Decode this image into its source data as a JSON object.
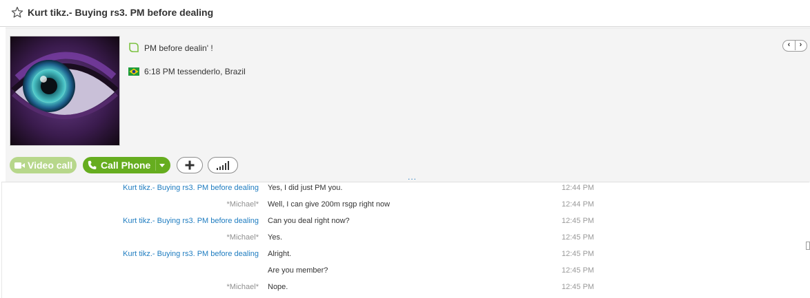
{
  "header": {
    "title": "Kurt tikz.- Buying rs3. PM before dealing"
  },
  "profile": {
    "mood": "PM before dealin' !",
    "location": "6:18 PM tessenderlo, Brazil",
    "mood_icon": "mood-bubble-icon",
    "flag_icon": "brazil-flag-icon"
  },
  "pager": {
    "prev": "‹",
    "next": "›"
  },
  "buttons": {
    "video_call": "Video call",
    "call_phone": "Call Phone",
    "add_icon": "plus-icon",
    "signal_icon": "signal-bars-icon",
    "more": "..."
  },
  "colors": {
    "call_green": "#66ad1f",
    "video_green_disabled": "#b7d78b",
    "link_blue": "#1e7cc0"
  },
  "messages": [
    {
      "sender": "Kurt tikz.- Buying rs3. PM before dealing",
      "from": "them",
      "text": "Yes, I did just PM you.",
      "time": "12:44 PM"
    },
    {
      "sender": "*Michael*",
      "from": "me",
      "text": "Well, I can give 200m rsgp right now",
      "time": "12:44 PM"
    },
    {
      "sender": "Kurt tikz.- Buying rs3. PM before dealing",
      "from": "them",
      "text": "Can you deal right now?",
      "time": "12:45 PM"
    },
    {
      "sender": "*Michael*",
      "from": "me",
      "text": "Yes.",
      "time": "12:45 PM"
    },
    {
      "sender": "Kurt tikz.- Buying rs3. PM before dealing",
      "from": "them",
      "text": "Alright.",
      "time": "12:45 PM"
    },
    {
      "sender": "",
      "from": "them",
      "text": "Are you member?",
      "time": "12:45 PM"
    },
    {
      "sender": "*Michael*",
      "from": "me",
      "text": "Nope.",
      "time": "12:45 PM"
    }
  ]
}
